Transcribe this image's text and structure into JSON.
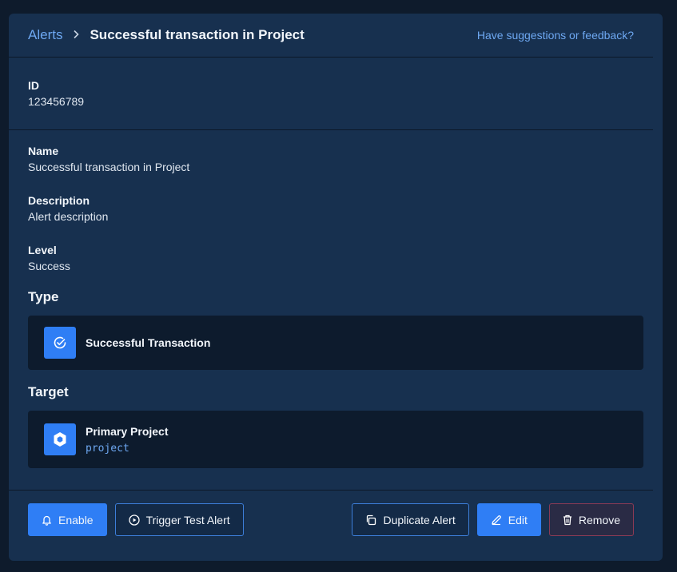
{
  "breadcrumb": {
    "parent": "Alerts",
    "separator": "›",
    "current": "Successful transaction in Project"
  },
  "header": {
    "feedback_link": "Have suggestions or feedback?"
  },
  "fields": {
    "id": {
      "label": "ID",
      "value": "123456789"
    },
    "name": {
      "label": "Name",
      "value": "Successful transaction in Project"
    },
    "description": {
      "label": "Description",
      "value": "Alert description"
    },
    "level": {
      "label": "Level",
      "value": "Success"
    }
  },
  "type_section": {
    "title": "Type",
    "card_title": "Successful Transaction",
    "icon": "check-circle-icon"
  },
  "target_section": {
    "title": "Target",
    "card_title": "Primary Project",
    "card_sub": "project",
    "icon": "project-hexagon-icon"
  },
  "actions": {
    "enable": "Enable",
    "trigger": "Trigger Test Alert",
    "duplicate": "Duplicate Alert",
    "edit": "Edit",
    "remove": "Remove"
  },
  "colors": {
    "background": "#0e1b2c",
    "panel": "#17304f",
    "card": "#0d1b2d",
    "accent": "#2f7ef5",
    "link": "#6ea8f2",
    "danger_border": "#8a3a55"
  }
}
